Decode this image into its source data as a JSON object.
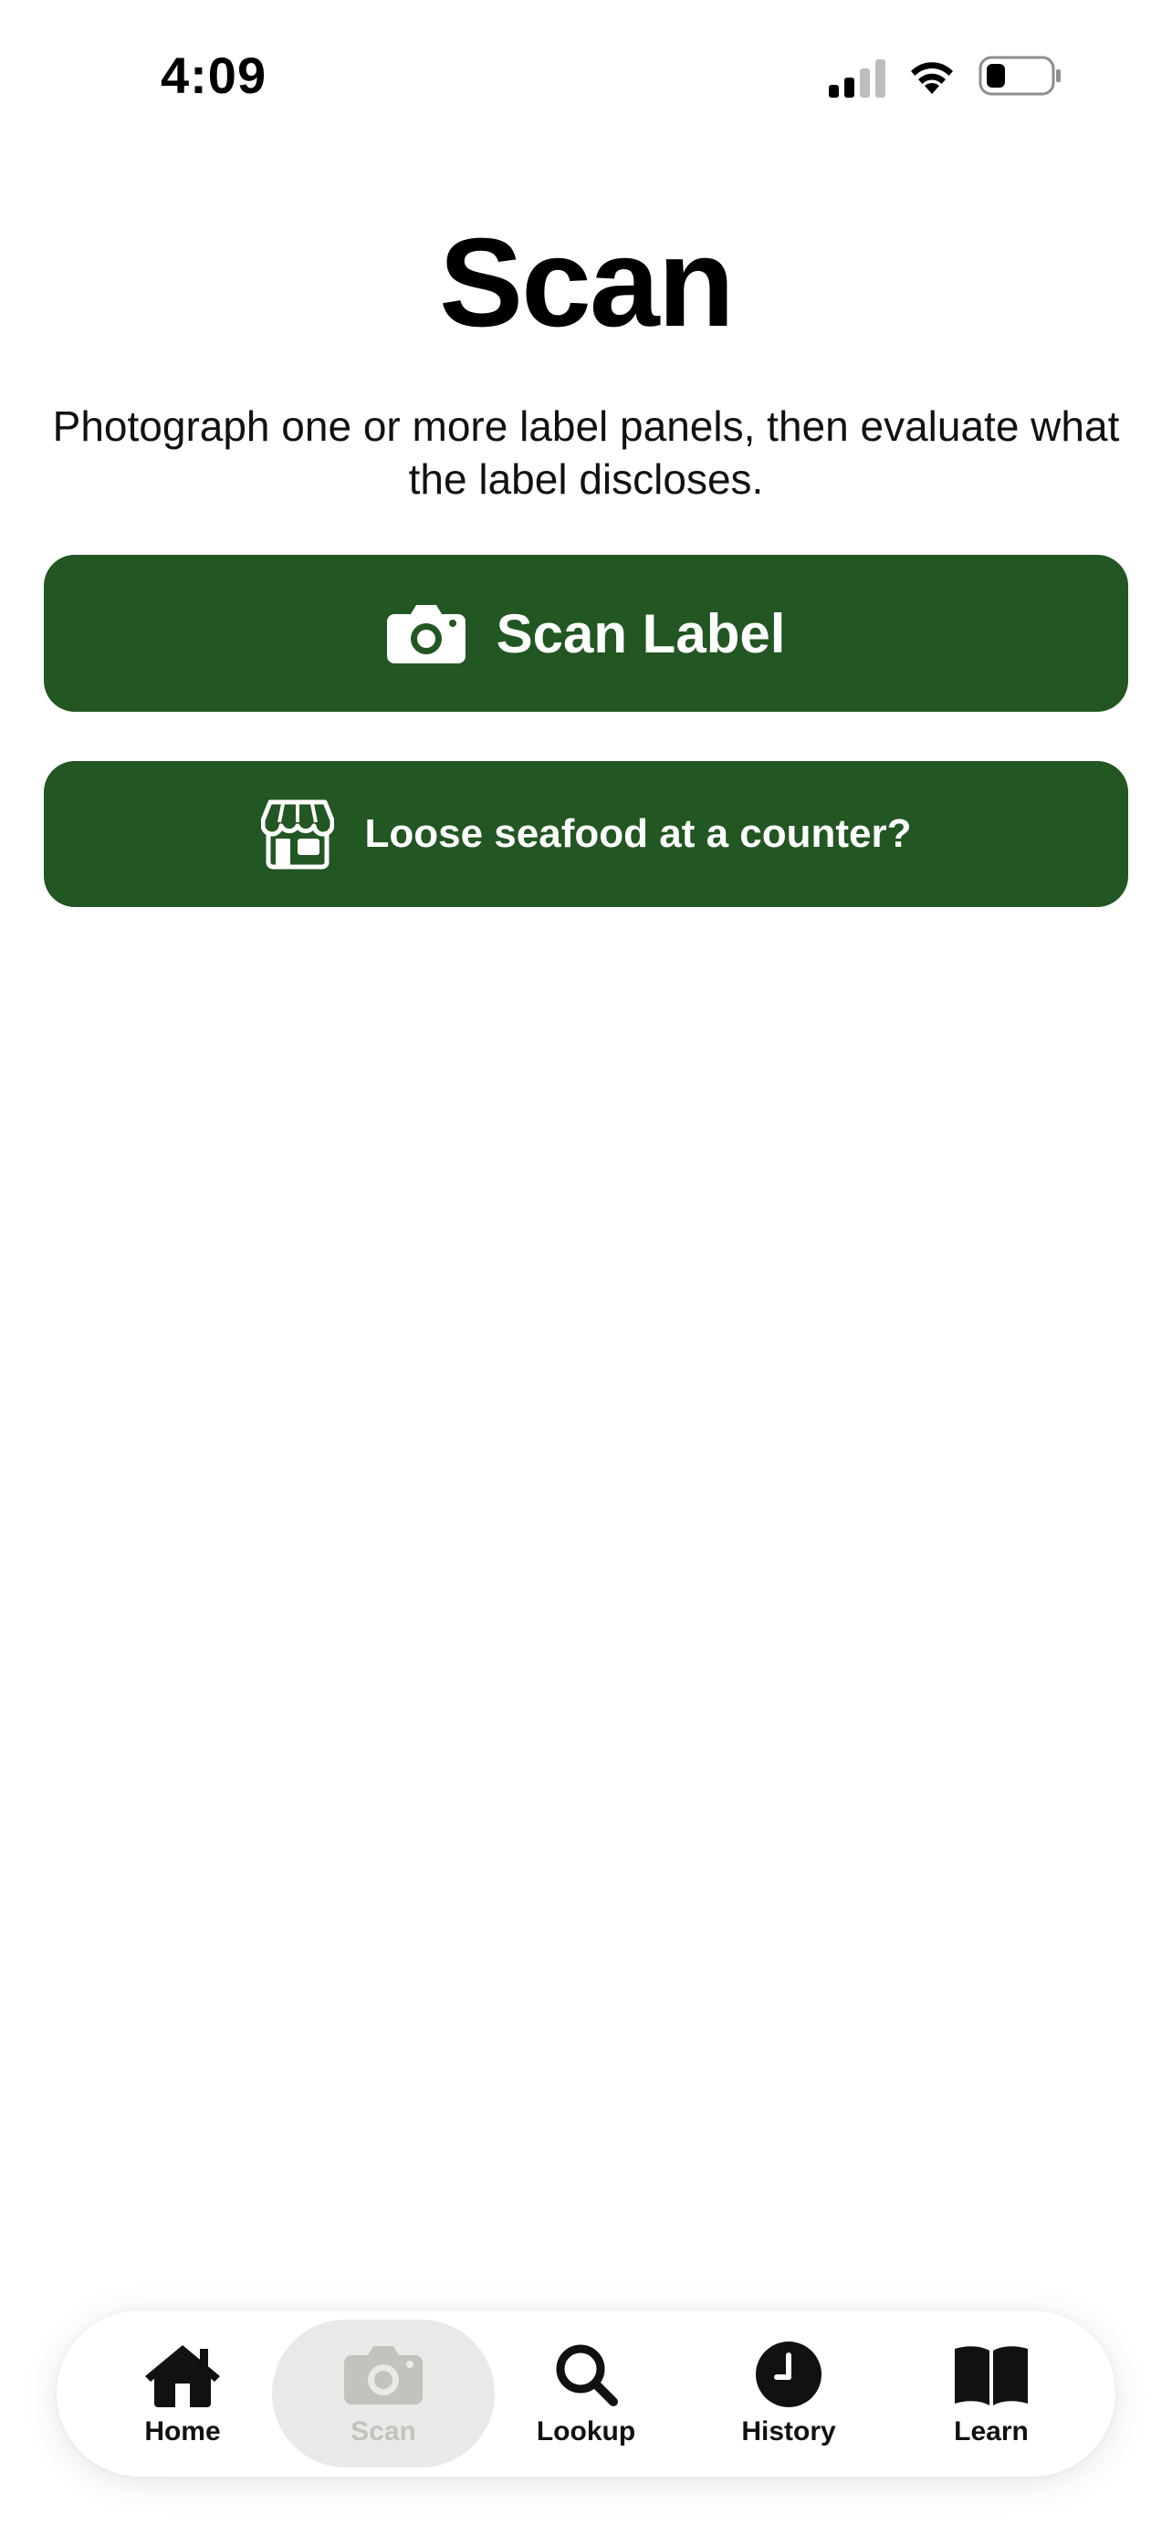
{
  "status_bar": {
    "time": "4:09",
    "signal_icon": "cellular-signal-icon",
    "wifi_icon": "wifi-icon",
    "battery_icon": "battery-low-icon"
  },
  "header": {
    "title": "Scan",
    "subtitle": "Photograph one or more label panels, then evaluate what the label discloses."
  },
  "actions": {
    "scan_label": {
      "label": "Scan Label",
      "icon": "camera-icon"
    },
    "counter": {
      "label": "Loose seafood at a counter?",
      "icon": "storefront-icon"
    }
  },
  "tab_bar": {
    "tabs": [
      {
        "label": "Home",
        "icon": "house-icon",
        "selected": false
      },
      {
        "label": "Scan",
        "icon": "camera-icon",
        "selected": true
      },
      {
        "label": "Lookup",
        "icon": "magnifying-glass-icon",
        "selected": false
      },
      {
        "label": "History",
        "icon": "clock-icon",
        "selected": false
      },
      {
        "label": "Learn",
        "icon": "book-icon",
        "selected": false
      }
    ]
  },
  "colors": {
    "button_green": "#225622",
    "tab_active_bg": "#e9e9e7",
    "tab_active_text": "#c2c2bf"
  }
}
